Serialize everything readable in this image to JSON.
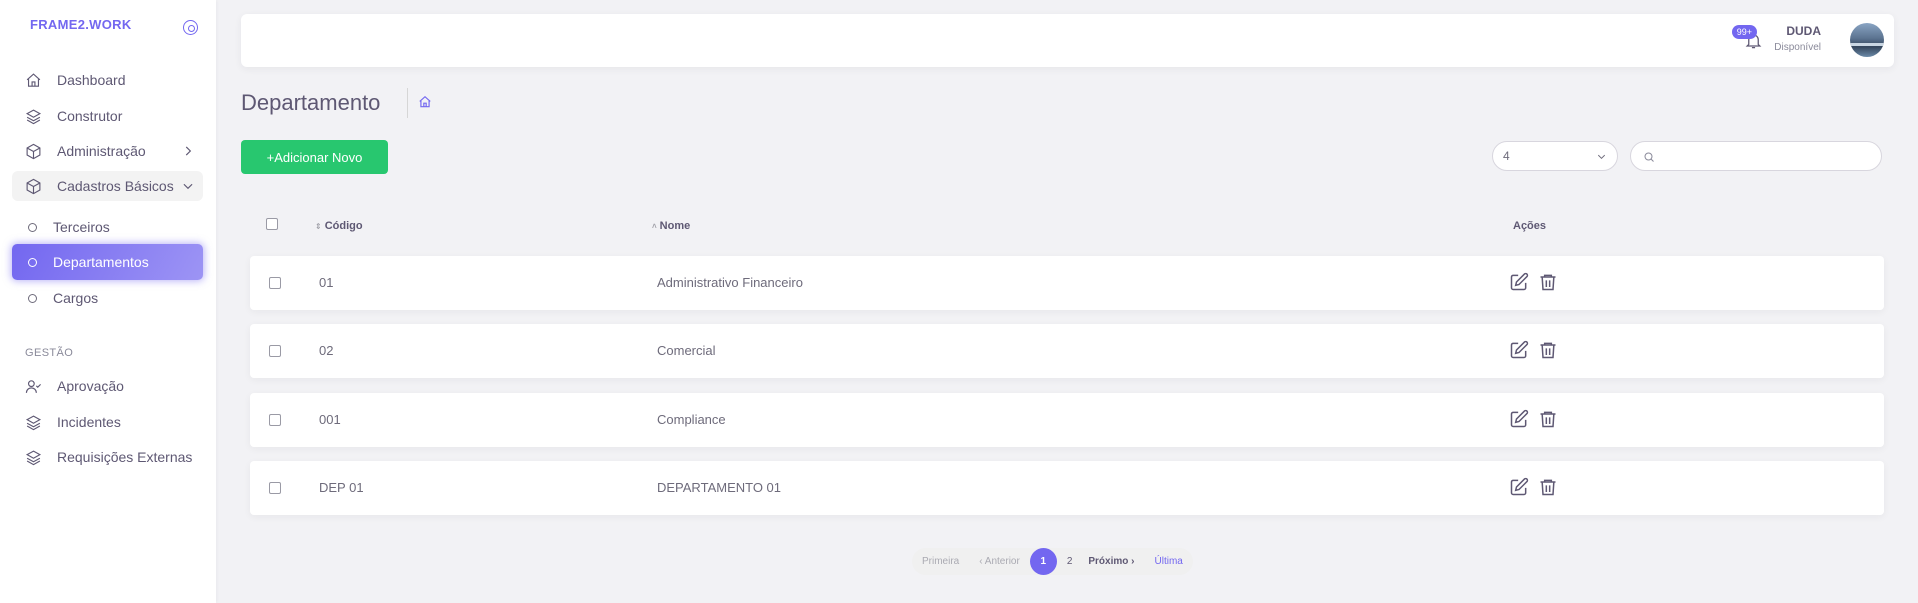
{
  "brand": "FRAME2.WORK",
  "sidebar": {
    "items": [
      {
        "label": "Dashboard",
        "icon": "home-icon"
      },
      {
        "label": "Construtor",
        "icon": "layers-icon"
      },
      {
        "label": "Administração",
        "icon": "box-icon"
      },
      {
        "label": "Cadastros Básicos",
        "icon": "box-icon"
      }
    ],
    "subitems": [
      {
        "label": "Terceiros"
      },
      {
        "label": "Departamentos"
      },
      {
        "label": "Cargos"
      }
    ],
    "section": "GESTÃO",
    "gestao": [
      {
        "label": "Aprovação",
        "icon": "user-check-icon"
      },
      {
        "label": "Incidentes",
        "icon": "layers-icon"
      },
      {
        "label": "Requisições Externas",
        "icon": "layers-icon"
      }
    ]
  },
  "navbar": {
    "badge": "99+",
    "user_name": "DUDA",
    "user_status": "Disponível"
  },
  "page": {
    "title": "Departamento",
    "add_button": "+Adicionar Novo",
    "per_page": "4",
    "search_placeholder": ""
  },
  "table": {
    "headers": {
      "code": "Código",
      "name": "Nome",
      "actions": "Ações"
    },
    "rows": [
      {
        "code": "01",
        "name": "Administrativo Financeiro"
      },
      {
        "code": "02",
        "name": "Comercial"
      },
      {
        "code": "001",
        "name": "Compliance"
      },
      {
        "code": "DEP 01",
        "name": "DEPARTAMENTO 01"
      }
    ]
  },
  "pagination": {
    "first": "Primeira",
    "prev": "‹ Anterior",
    "pages": [
      "1",
      "2"
    ],
    "next": "Próximo ›",
    "last": "Última"
  },
  "colors": {
    "accent": "#7367f0",
    "success": "#28c76f"
  }
}
